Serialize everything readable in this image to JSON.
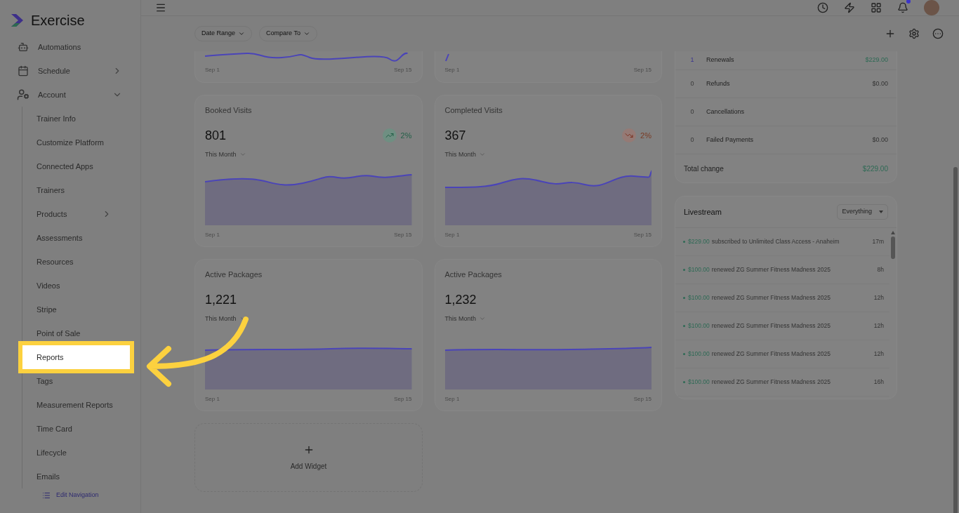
{
  "sidebar": {
    "logo": "Exercise",
    "items": [
      {
        "label": "Automations"
      },
      {
        "label": "Schedule",
        "expanded": false
      },
      {
        "label": "Account",
        "expanded": true,
        "children": [
          {
            "label": "Trainer Info",
            "highlighted": false
          },
          {
            "label": "Customize Platform",
            "highlighted": false
          },
          {
            "label": "Connected Apps",
            "highlighted": false
          },
          {
            "label": "Trainers",
            "highlighted": false
          },
          {
            "label": "Products",
            "highlighted": false,
            "expanded": false
          },
          {
            "label": "Assessments",
            "highlighted": false
          },
          {
            "label": "Resources",
            "highlighted": false
          },
          {
            "label": "Videos",
            "highlighted": false
          },
          {
            "label": "Stripe",
            "highlighted": false
          },
          {
            "label": "Point of Sale",
            "highlighted": false
          },
          {
            "label": "Reports",
            "highlighted": true
          },
          {
            "label": "Tags",
            "highlighted": false
          },
          {
            "label": "Measurement Reports",
            "highlighted": false
          },
          {
            "label": "Time Card",
            "highlighted": false
          },
          {
            "label": "Lifecycle",
            "highlighted": false
          },
          {
            "label": "Emails",
            "highlighted": false
          }
        ]
      }
    ],
    "footer": "Edit Navigation"
  },
  "topbar": {
    "notification_dot": true
  },
  "toolbar": {
    "filters": [
      "Date Range",
      "Compare To"
    ]
  },
  "fragments": [
    {
      "start": "Sep 1",
      "end": "Sep 15"
    },
    {
      "start": "Sep 1",
      "end": "Sep 15"
    }
  ],
  "metrics": [
    {
      "title": "Booked Visits",
      "value": "801",
      "trend": {
        "kind": "up",
        "text": "2%"
      },
      "period": "This Month",
      "start": "Sep 1",
      "end": "Sep 15"
    },
    {
      "title": "Completed Visits",
      "value": "367",
      "trend": {
        "kind": "down",
        "text": "2%"
      },
      "period": "This Month",
      "start": "Sep 1",
      "end": "Sep 15"
    },
    {
      "title": "Active Packages",
      "value": "1,221",
      "period": "This Month",
      "start": "Sep 1",
      "end": "Sep 15"
    },
    {
      "title": "Active Packages",
      "value": "1,232",
      "period": "This Month",
      "start": "Sep 1",
      "end": "Sep 15"
    }
  ],
  "add_widget": "Add Widget",
  "summary": {
    "rows": [
      {
        "count": "1",
        "label": "Renewals",
        "amount": "$229.00",
        "kind": "positive"
      },
      {
        "count": "0",
        "label": "Refunds",
        "amount": "$0.00",
        "kind": "neutral"
      },
      {
        "count": "0",
        "label": "Cancellations",
        "kind": "neutral"
      },
      {
        "count": "0",
        "label": "Failed Payments",
        "amount": "$0.00",
        "kind": "neutral"
      }
    ],
    "total_label": "Total change",
    "total": "$229.00"
  },
  "livestream": {
    "title": "Livestream",
    "filter": "Everything",
    "events": [
      {
        "amount": "$229.00",
        "text": "subscribed to Unlimited Class Access - Anaheim",
        "time": "17m"
      },
      {
        "amount": "$100.00",
        "text": "renewed ZG Summer Fitness Madness 2025",
        "time": "8h"
      },
      {
        "amount": "$100.00",
        "text": "renewed ZG Summer Fitness Madness 2025",
        "time": "12h"
      },
      {
        "amount": "$100.00",
        "text": "renewed ZG Summer Fitness Madness 2025",
        "time": "12h"
      },
      {
        "amount": "$100.00",
        "text": "renewed ZG Summer Fitness Madness 2025",
        "time": "12h"
      },
      {
        "amount": "$100.00",
        "text": "renewed ZG Summer Fitness Madness 2025",
        "time": "16h"
      }
    ]
  }
}
